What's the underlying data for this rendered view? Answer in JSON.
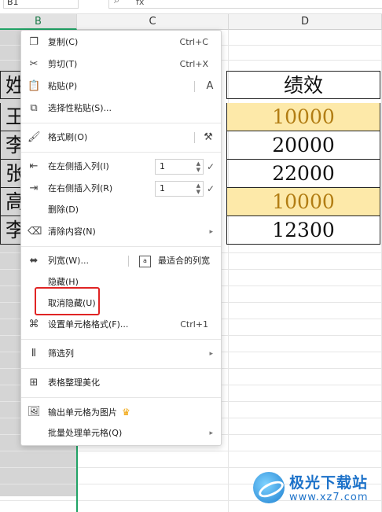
{
  "cell_ref": "B1",
  "formula_fx": "fx",
  "columns": {
    "b": "B",
    "c": "C",
    "d": "D"
  },
  "table": {
    "header": {
      "b_fragment": "姓",
      "d_value": "绩效"
    },
    "rows": [
      {
        "b_fragment": "王",
        "d_value": "10000",
        "highlight": true
      },
      {
        "b_fragment": "李",
        "d_value": "20000",
        "highlight": false
      },
      {
        "b_fragment": "张",
        "d_value": "22000",
        "highlight": false
      },
      {
        "b_fragment": "高",
        "d_value": "10000",
        "highlight": true
      },
      {
        "b_fragment": "李",
        "d_value": "12300",
        "highlight": false
      }
    ]
  },
  "menu": {
    "copy": {
      "label": "复制(C)",
      "shortcut": "Ctrl+C"
    },
    "cut": {
      "label": "剪切(T)",
      "shortcut": "Ctrl+X"
    },
    "paste": {
      "label": "粘贴(P)"
    },
    "paste_special": {
      "label": "选择性粘贴(S)..."
    },
    "format_painter": {
      "label": "格式刷(O)"
    },
    "insert_left": {
      "label": "在左侧插入列(I)",
      "value": "1"
    },
    "insert_right": {
      "label": "在右侧插入列(R)",
      "value": "1"
    },
    "delete": {
      "label": "删除(D)"
    },
    "clear": {
      "label": "清除内容(N)"
    },
    "col_width": {
      "label": "列宽(W)...",
      "best_fit": "最适合的列宽"
    },
    "hide": {
      "label": "隐藏(H)"
    },
    "unhide": {
      "label": "取消隐藏(U)"
    },
    "format_cells": {
      "label": "设置单元格格式(F)...",
      "shortcut": "Ctrl+1"
    },
    "filter_col": {
      "label": "筛选列"
    },
    "beautify": {
      "label": "表格整理美化"
    },
    "export_image": {
      "label": "输出单元格为图片"
    },
    "batch": {
      "label": "批量处理单元格(Q)"
    }
  },
  "watermark": {
    "title": "极光下载站",
    "url": "www.xz7.com"
  },
  "colors": {
    "accent_green": "#21a366",
    "highlight_fill": "#fde9a9",
    "highlight_text": "#b27d13",
    "red_box": "#e02424"
  }
}
